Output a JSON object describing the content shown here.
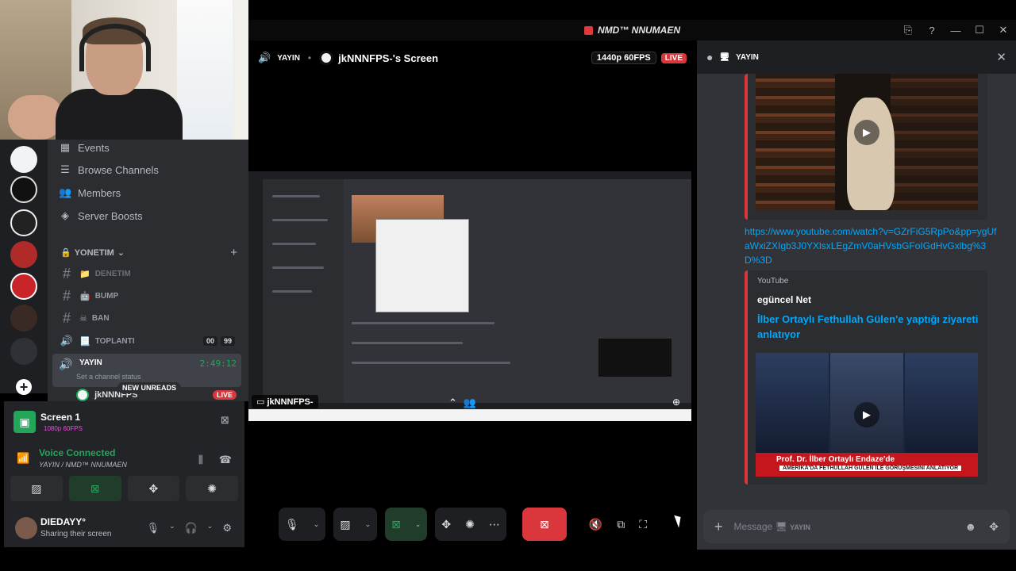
{
  "window": {
    "title": "NMD™ NNUMAEN",
    "controls": [
      "⎘",
      "?",
      "—",
      "☐",
      "✕"
    ]
  },
  "colors": {
    "accent_green": "#23a55a",
    "danger_red": "#da373c",
    "link_blue": "#00a8fc",
    "bg_dark": "#1e1f22",
    "bg_panel": "#2b2d31",
    "bg_chat": "#313338"
  },
  "sidebar": {
    "nav": [
      {
        "label": "Events",
        "icon": "calendar-icon"
      },
      {
        "label": "Browse Channels",
        "icon": "browse-channels-icon"
      },
      {
        "label": "Members",
        "icon": "members-icon"
      },
      {
        "label": "Server Boosts",
        "icon": "boost-icon"
      }
    ],
    "category": "YONETIM",
    "channels": [
      {
        "label": "DENETIM",
        "emoji": "📁"
      },
      {
        "label": "BUMP",
        "emoji": "🤖"
      },
      {
        "label": "BAN",
        "emoji": "☠"
      },
      {
        "label": "TOPLANTI",
        "emoji": "📃",
        "badges": [
          "00",
          "99"
        ]
      }
    ],
    "voice_channel": {
      "label": "YAYIN",
      "timer": "2:49:12",
      "status": "Set a channel status"
    },
    "voice_user": "jkNNNFPS",
    "new_unreads": "NEW UNREADS",
    "live": "LIVE"
  },
  "voice_panel": {
    "screen_title": "Screen 1",
    "screen_quality": "1080p 60FPS",
    "connected": "Voice Connected",
    "connected_sub": "YAYIN / NMD™ NNUMAEN",
    "user_name": "DIEDAYY°",
    "user_status": "Sharing their screen"
  },
  "stream": {
    "channel": "YAYIN",
    "screen_name": "jkNNNFPS-'s Screen",
    "quality": "1440p 60FPS",
    "live": "LIVE",
    "overlay_label": "jkNNNFPS-"
  },
  "chat": {
    "channel": "YAYIN",
    "link": "https://www.youtube.com/watch?v=GZrFiG5RpPo&pp=ygUfaWxiZXIgb3J0YXlsxLEgZmV0aHVsbGFoIGdHvGxlbg%3D%3D",
    "embed_provider": "YouTube",
    "embed_author": "egüncel Net",
    "embed_title": "İlber Ortaylı Fethullah Gülen'e yaptığı ziyareti anlatıyor",
    "tv_caption_1": "Prof. Dr. İlber Ortaylı Endaze'de",
    "tv_caption_2": "AMERİKA'DA FETHULLAH GÜLEN İLE GÖRÜŞMESİNİ ANLATIYOR",
    "message_placeholder": "Message",
    "message_channel": "YAYIN"
  }
}
